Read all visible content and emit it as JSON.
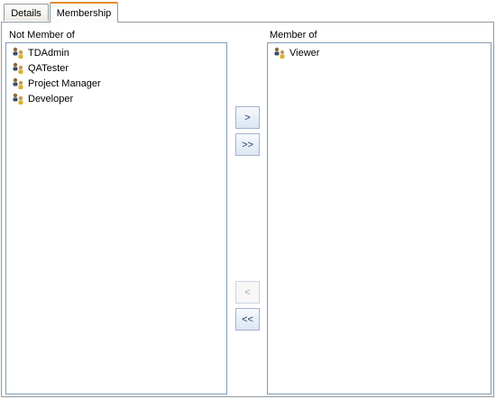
{
  "tabs": [
    {
      "label": "Details"
    },
    {
      "label": "Membership",
      "active": true
    }
  ],
  "not_member": {
    "label": "Not Member of",
    "items": [
      {
        "label": "TDAdmin",
        "icon": "user-group-icon"
      },
      {
        "label": "QATester",
        "icon": "user-group-icon"
      },
      {
        "label": "Project Manager",
        "icon": "user-group-icon"
      },
      {
        "label": "Developer",
        "icon": "user-group-icon"
      }
    ]
  },
  "member": {
    "label": "Member of",
    "items": [
      {
        "label": "Viewer",
        "icon": "user-group-icon"
      }
    ]
  },
  "buttons": {
    "add": ">",
    "add_all": ">>",
    "remove": "<",
    "remove_all": "<<"
  }
}
